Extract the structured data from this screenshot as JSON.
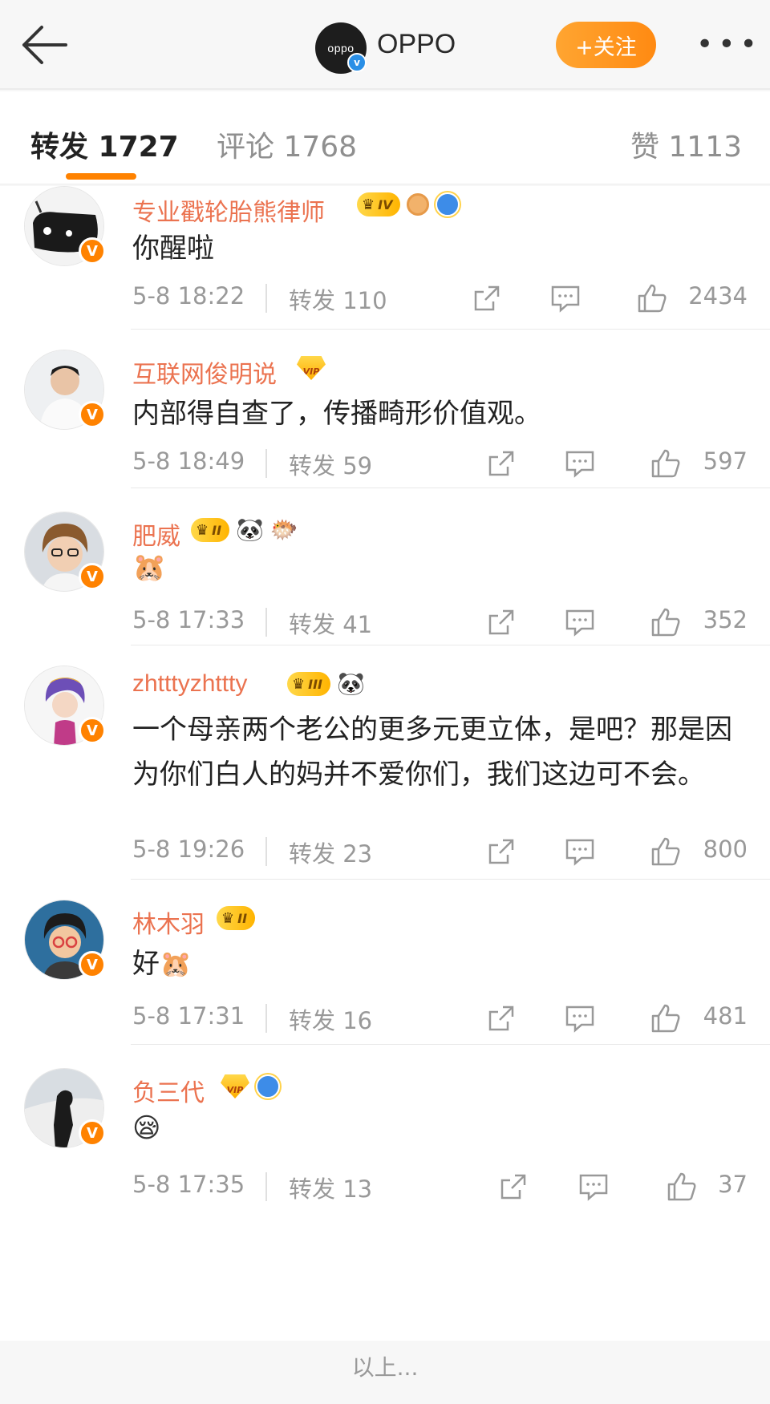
{
  "header": {
    "account_name": "OPPO",
    "logo_text": "oppo",
    "verified_mark": "v",
    "follow_label": "+关注",
    "more_label": "•••"
  },
  "tabs": {
    "repost": "转发 1727",
    "comment": "评论 1768",
    "like": "赞 1113"
  },
  "reposts": [
    {
      "name": "专业戳轮胎熊律师",
      "crown": "IV",
      "content": "你醒啦",
      "date": "5-8 18:22",
      "repost": "转发 110",
      "likes": "2434"
    },
    {
      "name": "互联网俊明说",
      "crown": "",
      "content": "内部得自查了，传播畸形价值观。",
      "date": "5-8 18:49",
      "repost": "转发 59",
      "likes": "597"
    },
    {
      "name": "肥威",
      "crown": "II",
      "content": "",
      "date": "5-8 17:33",
      "repost": "转发 41",
      "likes": "352"
    },
    {
      "name": "zhtttyzhttty",
      "crown": "III",
      "content": "一个母亲两个老公的更多元更立体，是吧？那是因为你们白人的妈并不爱你们，我们这边可不会。",
      "date": "5-8 19:26",
      "repost": "转发 23",
      "likes": "800"
    },
    {
      "name": "林木羽",
      "crown": "II",
      "content": "好",
      "date": "5-8 17:31",
      "repost": "转发 16",
      "likes": "481"
    },
    {
      "name": "负三代",
      "crown": "",
      "content": "",
      "date": "5-8 17:35",
      "repost": "转发 13",
      "likes": "37"
    }
  ],
  "badges": {
    "vip_label": "VIP",
    "v_mark": "V"
  },
  "footer": {
    "text": "以上..."
  },
  "colors": {
    "accent": "#ff8200",
    "username": "#eb7350",
    "muted": "#999999"
  }
}
